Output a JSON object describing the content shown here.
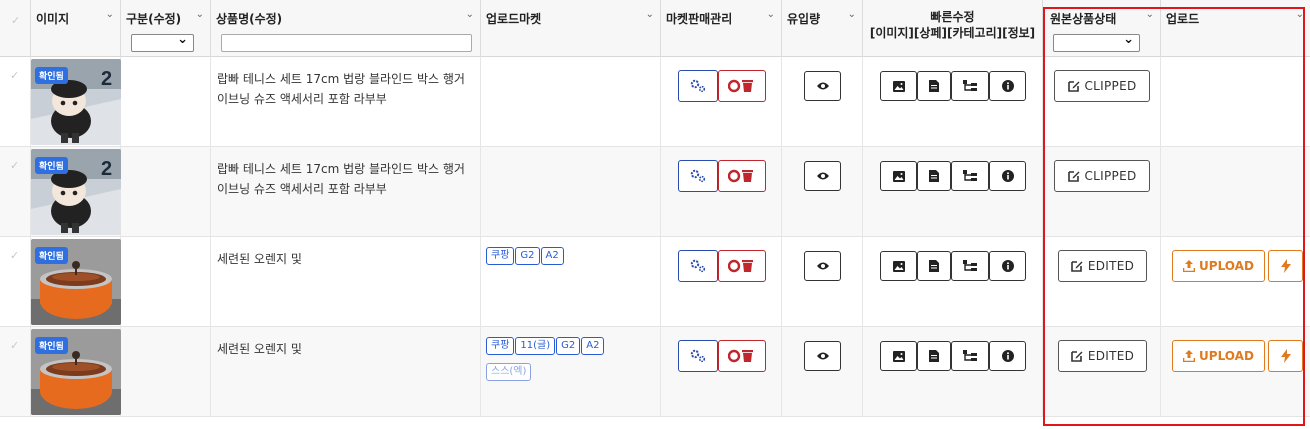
{
  "columns": {
    "image": "이미지",
    "category": "구분(수정)",
    "product_name": "상품명(수정)",
    "upload_market": "업로드마켓",
    "market_sales": "마켓판매관리",
    "inflow": "유입량",
    "quick_edit": "빠른수정",
    "quick_edit_sub": "[이미지][상페][카테고리][정보]",
    "original_status": "원본상품상태",
    "upload": "업로드"
  },
  "accent_red": "#e0161c",
  "rows": [
    {
      "badge": "확인됨",
      "name": "랍빠 테니스 세트 17cm 법랑 블라인드 박스 행거 이브닝 슈즈 액세서리 포함 라부부",
      "tags": [],
      "tags2": [],
      "status": "CLIPPED",
      "upload": ""
    },
    {
      "badge": "확인됨",
      "name": "랍빠 테니스 세트 17cm 법랑 블라인드 박스 행거 이브닝 슈즈 액세서리 포함 라부부",
      "tags": [],
      "tags2": [],
      "status": "CLIPPED",
      "upload": ""
    },
    {
      "badge": "확인됨",
      "name": "세련된 오렌지 및",
      "tags": [
        "쿠팡",
        "G2",
        "A2"
      ],
      "tags2": [],
      "status": "EDITED",
      "upload": "UPLOAD"
    },
    {
      "badge": "확인됨",
      "name": "세련된 오렌지 및",
      "tags": [
        "쿠팡",
        "11(글)",
        "G2",
        "A2"
      ],
      "tags2": [
        "스스(엑)"
      ],
      "status": "EDITED",
      "upload": "UPLOAD"
    }
  ]
}
